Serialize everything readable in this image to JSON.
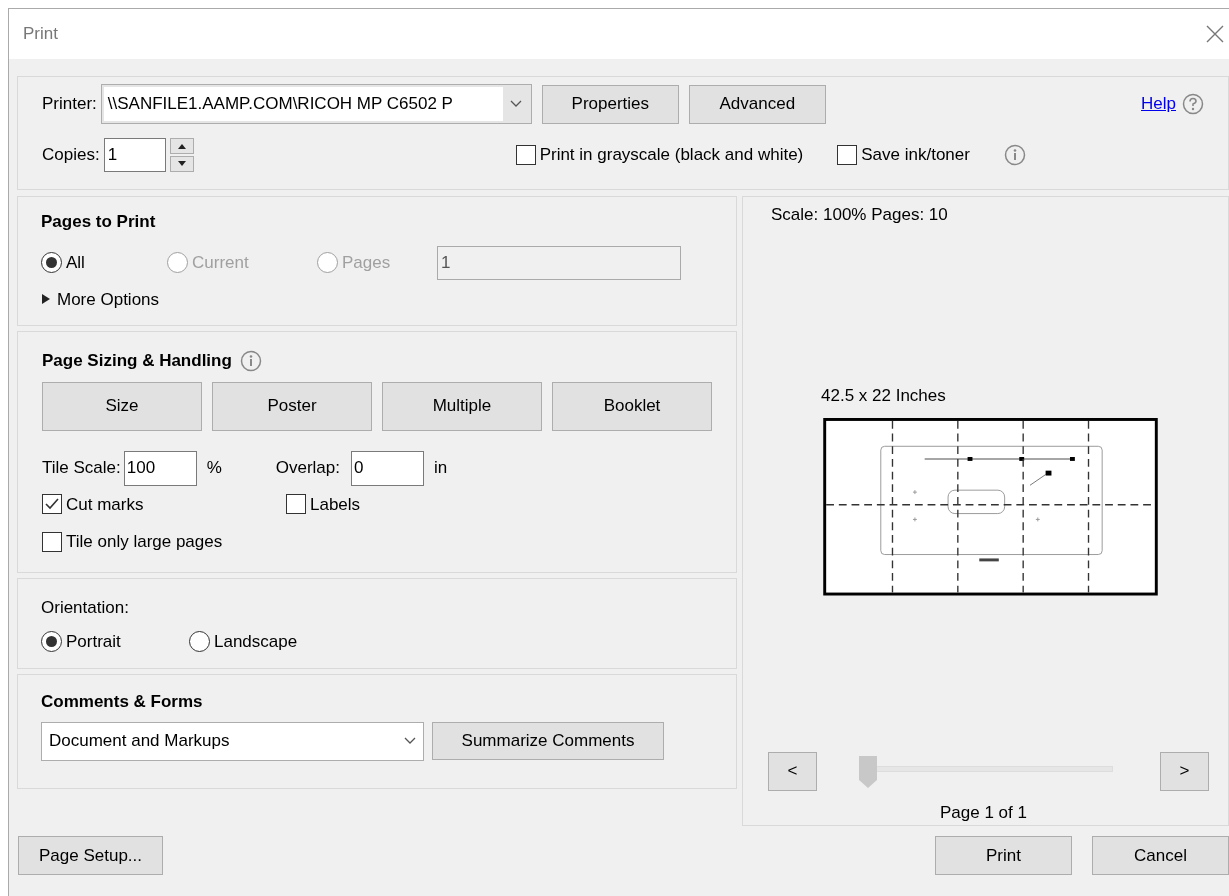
{
  "window": {
    "title": "Print"
  },
  "printer": {
    "label": "Printer:",
    "value": "\\\\SANFILE1.AAMP.COM\\RICOH MP C6502 P"
  },
  "top_buttons": [
    "Properties",
    "Advanced"
  ],
  "help": "Help",
  "copies": {
    "label": "Copies:",
    "value": "1"
  },
  "print_options": [
    {
      "label": "Print in grayscale (black and white)",
      "checked": false
    },
    {
      "label": "Save ink/toner",
      "checked": false
    }
  ],
  "pages_to_print": {
    "title": "Pages to Print",
    "options": [
      {
        "label": "All",
        "selected": true,
        "disabled": false
      },
      {
        "label": "Current",
        "selected": false,
        "disabled": true
      },
      {
        "label": "Pages",
        "selected": false,
        "disabled": true
      }
    ],
    "pages_field": {
      "value": "1",
      "disabled": true
    },
    "more_options": {
      "label": "More Options",
      "expanded": false
    }
  },
  "page_sizing": {
    "title": "Page Sizing & Handling",
    "modes": [
      "Size",
      "Poster",
      "Multiple",
      "Booklet"
    ],
    "tile_scale": {
      "label": "Tile Scale:",
      "value": "100",
      "unit": "%"
    },
    "overlap": {
      "label": "Overlap:",
      "value": "0",
      "unit": "in"
    },
    "checkboxes": [
      {
        "label": "Cut marks",
        "checked": true
      },
      {
        "label": "Labels",
        "checked": false
      },
      {
        "label": "Tile only large pages",
        "checked": false
      }
    ]
  },
  "orientation": {
    "label": "Orientation:",
    "options": [
      {
        "label": "Portrait",
        "selected": true
      },
      {
        "label": "Landscape",
        "selected": false
      }
    ]
  },
  "comments": {
    "title": "Comments & Forms",
    "value": "Document and Markups",
    "button": "Summarize Comments"
  },
  "preview": {
    "scale_text": "Scale: 100% Pages: 10",
    "size_text": "42.5 x 22 Inches",
    "prev": "<",
    "next": ">",
    "slider": {
      "level": 0
    },
    "page_text": "Page 1 of 1"
  },
  "footer": {
    "page_setup": "Page Setup...",
    "print": "Print",
    "cancel": "Cancel"
  }
}
